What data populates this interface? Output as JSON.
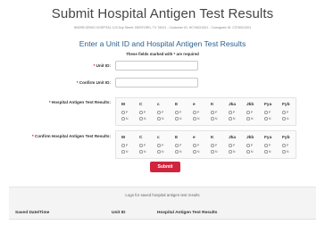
{
  "header": {
    "title": "Submit Hospital Antigen Test Results",
    "address": "IMGRB DEMO HOSPITAL 123 Any Street,  BEDFORD, TX 76021 - Customer ID: HCY6021001 - Consignee ID: CS76021001",
    "subtitle": "Enter a Unit ID and Hospital Antigen Test Results",
    "required_note": "These fields marked with * are required"
  },
  "form": {
    "unit_id": {
      "label": "Unit ID:",
      "value": ""
    },
    "confirm_unit_id": {
      "label": "Confirm Unit ID:",
      "value": ""
    },
    "results": {
      "label": "Hospital Antigen Test Results:"
    },
    "confirm_results": {
      "label": "Confirm Hospital Antigen Test Results:"
    },
    "antigens": [
      "M",
      "C",
      "c",
      "E",
      "e",
      "K",
      "Jka",
      "Jkb",
      "Fya",
      "Fyb"
    ],
    "option_pos": "P",
    "option_neg": "N",
    "required_mark": "*",
    "submit_label": "Submit"
  },
  "logs": {
    "title": "Logs for saved hospital antigen test results",
    "columns": [
      "Saved Date/Time",
      "Unit ID",
      "Hospital Antigen Test Results"
    ]
  },
  "colors": {
    "accent": "#d0243e",
    "subtitle": "#2a5f8f"
  }
}
